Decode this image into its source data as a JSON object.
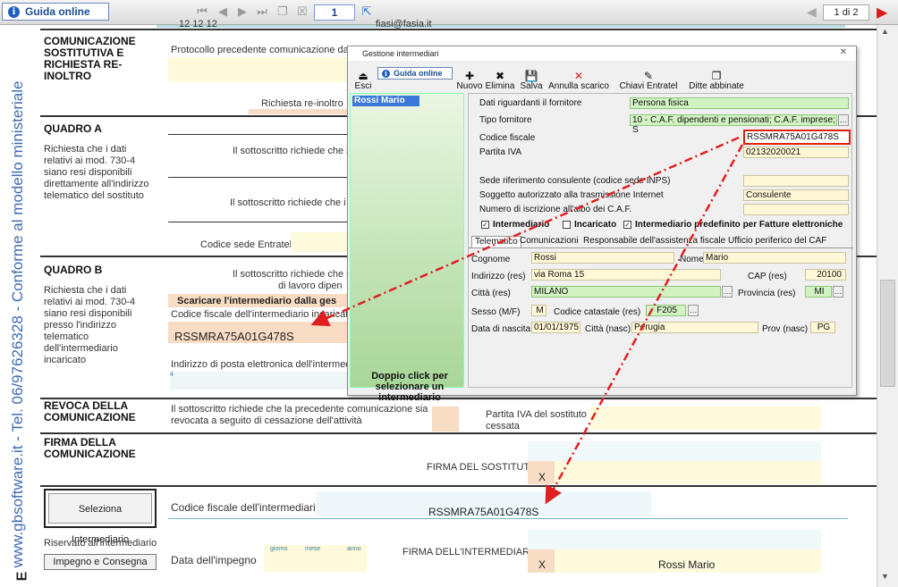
{
  "toolbar": {
    "guida": "Guida online",
    "page": "1",
    "pages_of": "1 di 2"
  },
  "sidebar": {
    "text": "www.gbsoftware.it - Tel. 06/97626328 - Conforme al modello ministeriale"
  },
  "form": {
    "top_partial": "12 12 12",
    "top_email": "fiasi@fasia.it",
    "s1_title": "COMUNICAZIONE SOSTITUTIVA E RICHIESTA RE-INOLTRO",
    "s1_protocollo": "Protocollo precedente comunicazione da so",
    "s1_richiesta": "Richiesta re-inoltro",
    "qa_title": "QUADRO A",
    "qa_text": "Richiesta che i dati relativi ai mod. 730-4 siano resi disponibili direttamente all'indirizzo telematico del sostituto",
    "qa_line1": "Il sottoscritto richiede che i",
    "qa_line2": "Il sottoscritto richiede che i",
    "qa_codice": "Codice sede Entratel",
    "qb_title": "QUADRO B",
    "qb_text": "Richiesta che i dati relativi ai mod. 730-4 siano resi disponibili presso l'indirizzo telematico dell'intermediario incaricato",
    "qb_line1": "Il sottoscritto richiede che i",
    "qb_line1b": "di lavoro dipen",
    "qb_scaricare": "Scaricare l'intermediario dalla ges",
    "qb_cf_label": "Codice fiscale dell'intermediario incaricato",
    "qb_cf_value": "RSSMRA75A01G478S",
    "qb_pec": "Indirizzo di posta elettronica dell'intermedio",
    "qb_pec_num": "4",
    "rev_title": "REVOCA DELLA COMUNICAZIONE",
    "rev_text": "Il sottoscritto richiede che la precedente comunicazione sia revocata a seguito di cessazione dell'attività",
    "rev_piva": "Partita IVA del sostituto cessata",
    "firma_title": "FIRMA DELLA COMUNICAZIONE",
    "firma_sostituto": "FIRMA DEL SOSTITUTO",
    "firma_x": "X",
    "sel_btn": "Seleziona Intermediario",
    "int_cf_label": "Codice fiscale dell'intermediario",
    "int_cf_value": "RSSMRA75A01G478S",
    "riservato": "Riservato all'intermediario",
    "impegno_btn": "Impegno e Consegna",
    "data_impegno": "Data dell'impegno",
    "giorno": "giorno",
    "mese": "mese",
    "anno": "anno",
    "firma_int": "FIRMA DELL'INTERMEDIARIO",
    "firma_int_x": "X",
    "firma_int_name": "Rossi Mario"
  },
  "dialog": {
    "title": "Gestione intermediari",
    "esci": "Esci",
    "guida": "Guida online",
    "nuovo": "Nuovo",
    "elimina": "Elimina",
    "salva": "Salva",
    "annulla": "Annulla scarico",
    "chiavi": "Chiavi Entratel",
    "ditte": "Ditte abbinate",
    "list_item": "Rossi Mario",
    "hint": "Doppio click per selezionare un intermediario",
    "l_dati": "Dati riguardanti il fornitore",
    "v_dati": "Persona fisica",
    "l_tipo": "Tipo fornitore",
    "v_tipo": "10 - C.A.F. dipendenti e pensionati; C.A.F. imprese; S",
    "l_cf": "Codice fiscale",
    "v_cf": "RSSMRA75A01G478S",
    "l_piva": "Partita IVA",
    "v_piva": "02132020021",
    "l_sede": "Sede riferimento consulente (codice sede INPS)",
    "l_sogg": "Soggetto autorizzato alla trasmissione Internet",
    "v_sogg": "Consulente",
    "l_num": "Numero di iscrizione all'albo dei C.A.F.",
    "c_int": "Intermediario",
    "c_inc": "Incaricato",
    "c_pred": "Intermediario predefinito per Fatture elettroniche",
    "tabs": [
      "Telematico",
      "Comunicazioni",
      "Responsabile dell'assistenza fiscale",
      "Ufficio periferico del CAF"
    ],
    "l_cognome": "Cognome",
    "v_cognome": "Rossi",
    "l_nome": "Nome",
    "v_nome": "Mario",
    "l_ind": "Indirizzo (res)",
    "v_ind": "via Roma 15",
    "l_cap": "CAP (res)",
    "v_cap": "20100",
    "l_citta": "Città (res)",
    "v_citta": "MILANO",
    "l_prov": "Provincia (res)",
    "v_prov": "MI",
    "l_sesso": "Sesso (M/F)",
    "v_sesso": "M",
    "l_catast": "Codice catastale (res)",
    "v_catast": "F205",
    "l_nascita": "Data di nascita",
    "v_nascita": "01/01/1975",
    "l_cittan": "Città (nasc)",
    "v_cittan": "Perugia",
    "l_provn": "Prov (nasc)",
    "v_provn": "PG"
  },
  "colors": {
    "teal": "#b7dde3",
    "yellow": "#fefadc",
    "arrow": "#e02020"
  }
}
